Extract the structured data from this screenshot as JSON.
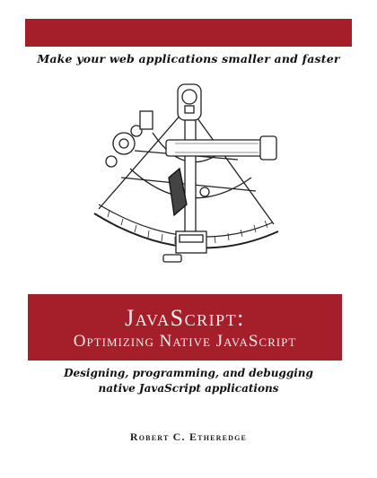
{
  "cover": {
    "tagline": "Make your web applications smaller and faster",
    "title_line1": "JavaScript:",
    "title_line2": "Optimizing Native JavaScript",
    "subtitle_line1": "Designing, programming, and debugging",
    "subtitle_line2": "native JavaScript applications",
    "author": "Robert C. Etheredge",
    "illustration": "sextant-engraving",
    "colors": {
      "band": "#a51f2b",
      "band_text": "#f6eaea",
      "ink": "#111111"
    }
  }
}
